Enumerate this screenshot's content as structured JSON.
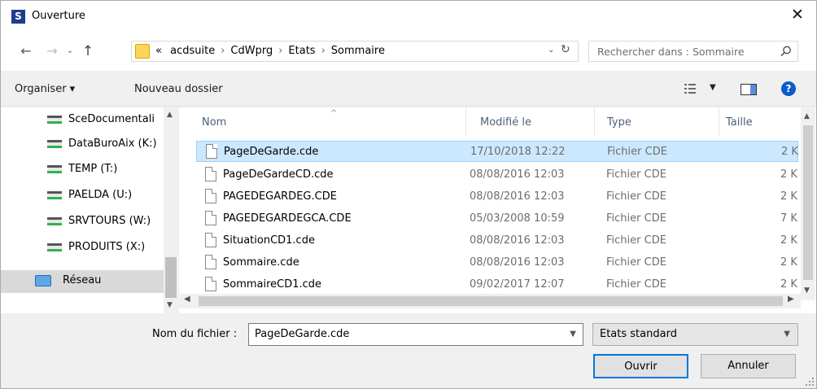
{
  "window": {
    "title": "Ouverture",
    "app_icon_letter": "S",
    "close_glyph": "✕",
    "accent": "#0078d7"
  },
  "nav": {
    "back": "←",
    "forward": "→",
    "history_dropdown": "⌄",
    "up": "↑"
  },
  "address": {
    "overflow": "«",
    "crumbs": [
      "acdsuite",
      "CdWprg",
      "Etats",
      "Sommaire"
    ],
    "separator": "›",
    "dropdown": "⌄",
    "refresh": "↻"
  },
  "search": {
    "placeholder": "Rechercher dans : Sommaire"
  },
  "toolbar": {
    "organize": "Organiser ▾",
    "new_folder": "Nouveau dossier",
    "view_dropdown": "▼",
    "help": "?"
  },
  "sidebar": {
    "items": [
      {
        "label": "SceDocumentali",
        "icon": "network-drive-icon"
      },
      {
        "label": "DataBuroAix (K:)",
        "icon": "network-drive-icon"
      },
      {
        "label": "TEMP (T:)",
        "icon": "network-drive-icon"
      },
      {
        "label": "PAELDA (U:)",
        "icon": "network-drive-icon"
      },
      {
        "label": "SRVTOURS (W:)",
        "icon": "network-drive-icon"
      },
      {
        "label": "PRODUITS (X:)",
        "icon": "network-drive-icon"
      },
      {
        "label": "Réseau",
        "icon": "network-icon"
      }
    ]
  },
  "filelist": {
    "columns": {
      "name": "Nom",
      "modified": "Modifié le",
      "type": "Type",
      "size": "Taille"
    },
    "rows": [
      {
        "name": "PageDeGarde.cde",
        "modified": "17/10/2018 12:22",
        "type": "Fichier CDE",
        "size": "2 K",
        "selected": true
      },
      {
        "name": "PageDeGardeCD.cde",
        "modified": "08/08/2016 12:03",
        "type": "Fichier CDE",
        "size": "2 K"
      },
      {
        "name": "PAGEDEGARDEG.CDE",
        "modified": "08/08/2016 12:03",
        "type": "Fichier CDE",
        "size": "2 K"
      },
      {
        "name": "PAGEDEGARDEGCA.CDE",
        "modified": "05/03/2008 10:59",
        "type": "Fichier CDE",
        "size": "7 K"
      },
      {
        "name": "SituationCD1.cde",
        "modified": "08/08/2016 12:03",
        "type": "Fichier CDE",
        "size": "2 K"
      },
      {
        "name": "Sommaire.cde",
        "modified": "08/08/2016 12:03",
        "type": "Fichier CDE",
        "size": "2 K"
      },
      {
        "name": "SommaireCD1.cde",
        "modified": "09/02/2017 12:07",
        "type": "Fichier CDE",
        "size": "2 K"
      }
    ]
  },
  "footer": {
    "filename_label": "Nom du fichier :",
    "filename_value": "PageDeGarde.cde",
    "filetype_value": "Etats standard",
    "open_label": "Ouvrir",
    "cancel_label": "Annuler"
  }
}
